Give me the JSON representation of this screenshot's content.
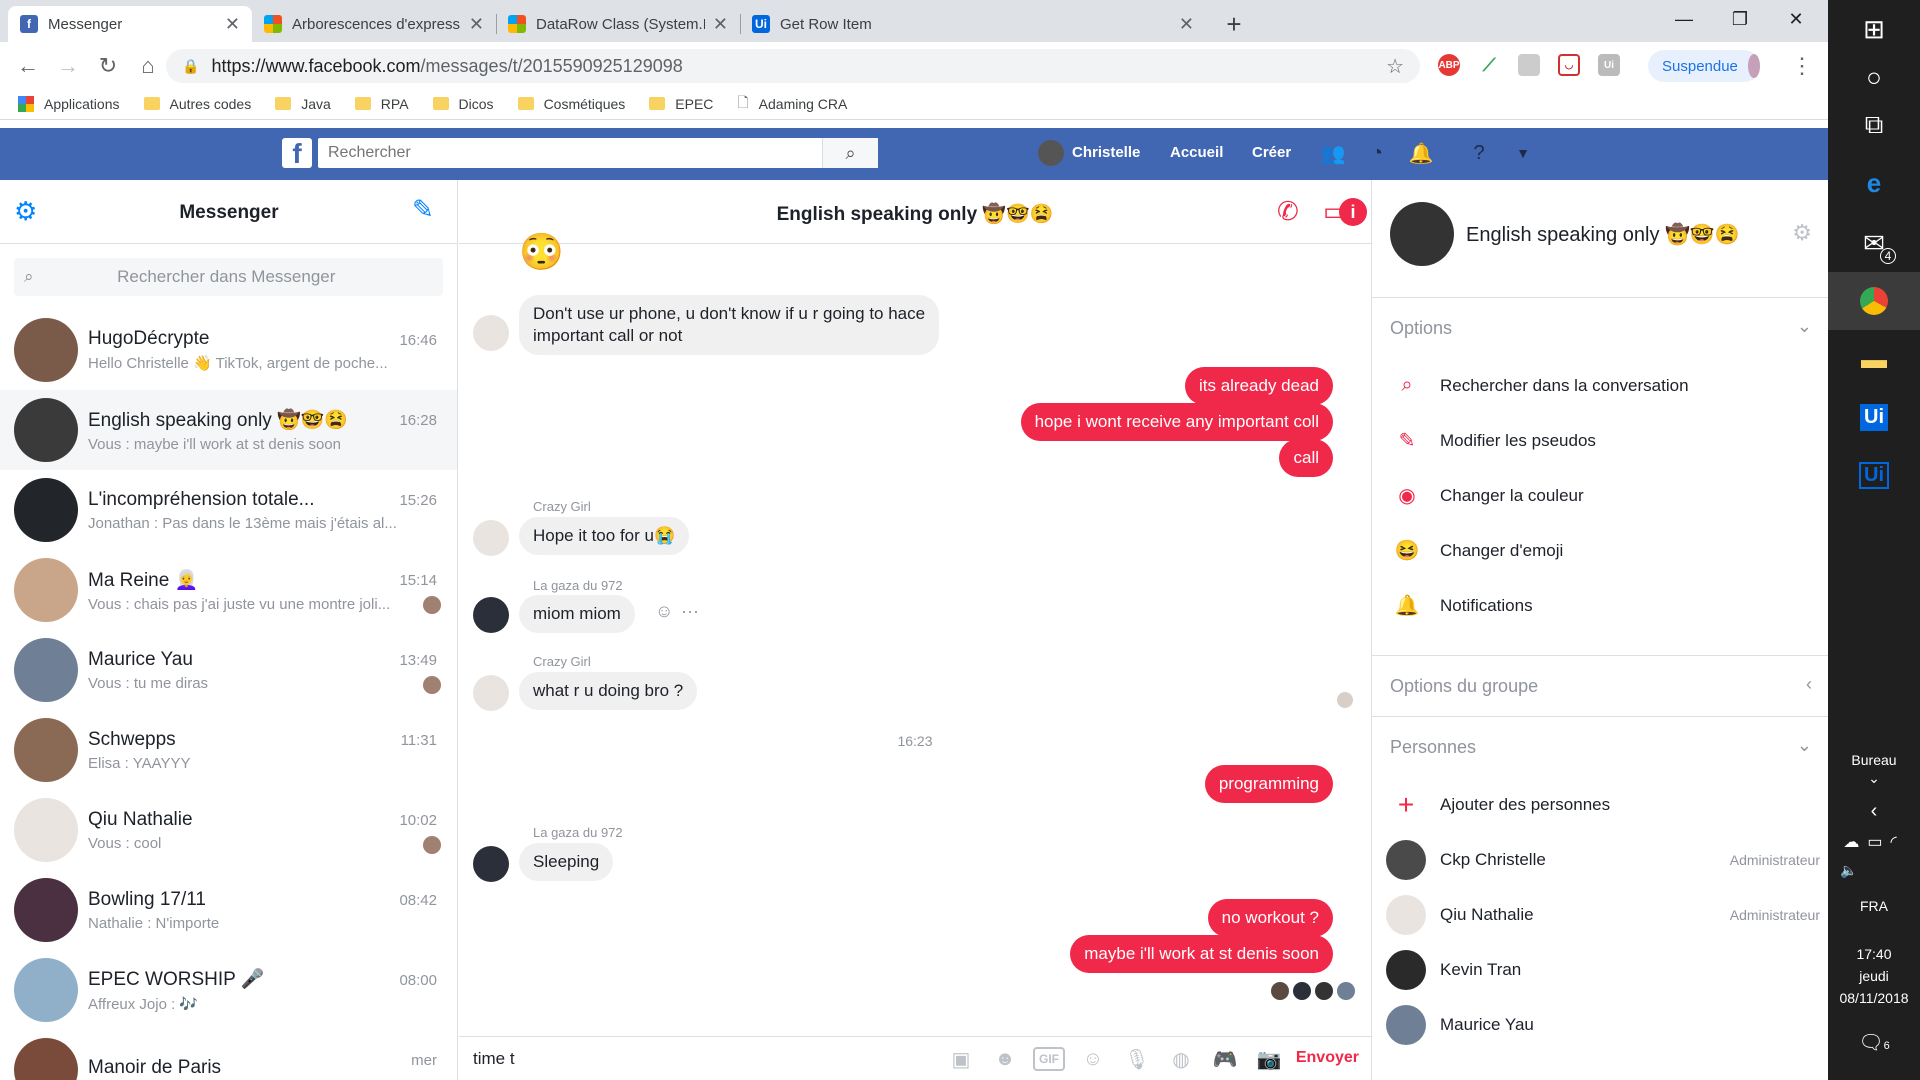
{
  "browser": {
    "tabs": [
      {
        "title": "Messenger",
        "favicon": "facebook-icon",
        "color": "#4267b2",
        "glyph": "f",
        "active": true
      },
      {
        "title": "Arborescences d'expressions (Visual C#)",
        "favicon": "microsoft-icon",
        "color": "#f25022",
        "glyph": "",
        "active": false
      },
      {
        "title": "DataRow Class (System.Data) | Microsoft Docs",
        "favicon": "microsoft-icon",
        "color": "#f25022",
        "glyph": "",
        "active": false
      },
      {
        "title": "Get Row Item",
        "favicon": "uipath-icon",
        "color": "#0067df",
        "glyph": "Ui",
        "active": false
      }
    ],
    "window_controls": {
      "minimize": "—",
      "restore": "❐",
      "close": "✕"
    },
    "url_host": "https://www.facebook.com",
    "url_path": "/messages/t/2015590925129098",
    "profile_label": "Suspendue",
    "bookmarks": [
      "Applications",
      "Autres codes",
      "Java",
      "RPA",
      "Dicos",
      "Cosmétiques",
      "EPEC",
      "Adaming CRA"
    ]
  },
  "fb": {
    "search_placeholder": "Rechercher",
    "user_name": "Christelle",
    "nav_home": "Accueil",
    "nav_create": "Créer",
    "brand_color": "#4267b2"
  },
  "messenger": {
    "title": "Messenger",
    "search_placeholder": "Rechercher dans Messenger",
    "conversations": [
      {
        "name": "HugoDécrypte",
        "snippet": "Hello Christelle 👋 TikTok, argent de poche...",
        "time": "16:46",
        "avatar_color": "#7a5a48",
        "selected": false,
        "seen": false
      },
      {
        "name": "English speaking only 🤠🤓😫",
        "snippet": "Vous : maybe i'll work at st denis soon",
        "time": "16:28",
        "avatar_color": "#3a3a3a",
        "selected": true,
        "seen": false
      },
      {
        "name": "L'incompréhension totale...",
        "snippet": "Jonathan : Pas dans le 13ème mais j'étais al...",
        "time": "15:26",
        "avatar_color": "#22262a",
        "selected": false,
        "seen": false
      },
      {
        "name": "Ma Reine 👩‍🦳",
        "snippet": "Vous : chais pas j'ai juste vu une montre joli...",
        "time": "15:14",
        "avatar_color": "#c9a68a",
        "selected": false,
        "seen": true
      },
      {
        "name": "Maurice Yau",
        "snippet": "Vous : tu me diras",
        "time": "13:49",
        "avatar_color": "#6f7f96",
        "selected": false,
        "seen": true
      },
      {
        "name": "Schwepps",
        "snippet": "Elisa : YAAYYY",
        "time": "11:31",
        "avatar_color": "#8a6a55",
        "selected": false,
        "seen": false
      },
      {
        "name": "Qiu Nathalie",
        "snippet": "Vous : cool",
        "time": "10:02",
        "avatar_color": "#e9e4e0",
        "selected": false,
        "seen": true
      },
      {
        "name": "Bowling 17/11",
        "snippet": "Nathalie : N'importe",
        "time": "08:42",
        "avatar_color": "#4a3040",
        "selected": false,
        "seen": false
      },
      {
        "name": "EPEC WORSHIP 🎤",
        "snippet": "Affreux Jojo : 🎶",
        "time": "08:00",
        "avatar_color": "#8fb0c8",
        "selected": false,
        "seen": false
      },
      {
        "name": "Manoir de Paris",
        "snippet": "",
        "time": "mer",
        "avatar_color": "#7a4a3a",
        "selected": false,
        "seen": false
      }
    ]
  },
  "chat": {
    "title": "English speaking only 🤠🤓😫",
    "top_emoji": "😳",
    "messages": [
      {
        "text": "Don't use ur phone, u don't know if u r going to hace",
        "text2": "important call or not"
      },
      {
        "text": "its already dead"
      },
      {
        "text": "hope i wont receive any important coll"
      },
      {
        "text": "call"
      },
      {
        "sender": "Crazy Girl",
        "text": "Hope it too for u😭"
      },
      {
        "sender": "La gaza du 972",
        "text": "miom miom"
      },
      {
        "sender": "Crazy Girl",
        "text": "what r u doing bro ?"
      },
      {
        "text": "programming"
      },
      {
        "sender": "La gaza du 972",
        "text": "Sleeping"
      },
      {
        "text": "no workout ?"
      },
      {
        "text": "maybe i'll work at st denis soon"
      }
    ],
    "timestamp": "16:23",
    "reaction_icon": "☺",
    "more_icon": "···",
    "composer_value": "time t",
    "send_label": "Envoyer",
    "accent": "#f02849"
  },
  "details": {
    "name": "English speaking only 🤠🤓😫",
    "options_title": "Options",
    "options": [
      {
        "label": "Rechercher dans la conversation",
        "icon": "search-icon",
        "glyph": "⌕"
      },
      {
        "label": "Modifier les pseudos",
        "icon": "pencil-icon",
        "glyph": "✎"
      },
      {
        "label": "Changer la couleur",
        "icon": "palette-icon",
        "glyph": "◉"
      },
      {
        "label": "Changer d'emoji",
        "icon": "emoji-icon",
        "glyph": "😆"
      },
      {
        "label": "Notifications",
        "icon": "bell-icon",
        "glyph": "🔔"
      }
    ],
    "group_options_title": "Options du groupe",
    "people_title": "Personnes",
    "add_people": "Ajouter des personnes",
    "people": [
      {
        "name": "Ckp Christelle",
        "role": "Administrateur",
        "color": "#4a4a4a"
      },
      {
        "name": "Qiu Nathalie",
        "role": "Administrateur",
        "color": "#e9e4e0"
      },
      {
        "name": "Kevin Tran",
        "role": "",
        "color": "#2a2a2a"
      },
      {
        "name": "Maurice Yau",
        "role": "",
        "color": "#6f7f96"
      }
    ]
  },
  "taskbar": {
    "mail_badge": "4",
    "desktop_label": "Bureau",
    "language": "FRA",
    "time": "17:40",
    "day": "jeudi",
    "date": "08/11/2018",
    "notif_badge": "6"
  }
}
